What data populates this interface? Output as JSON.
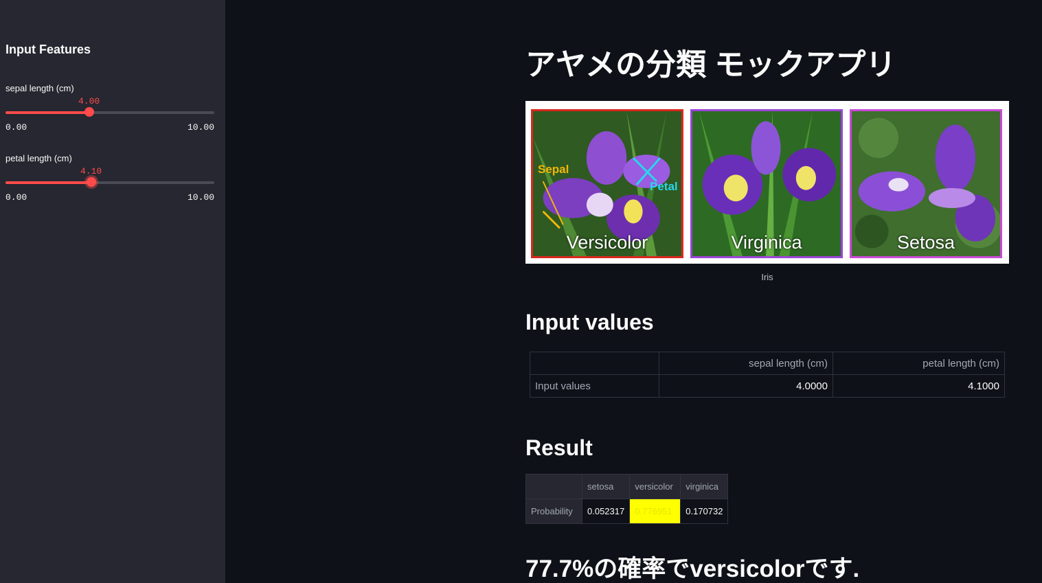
{
  "sidebar": {
    "title": "Input Features",
    "sliders": [
      {
        "label": "sepal length (cm)",
        "value": 4.0,
        "value_text": "4.00",
        "min_text": "0.00",
        "max_text": "10.00"
      },
      {
        "label": "petal length (cm)",
        "value": 4.1,
        "value_text": "4.10",
        "min_text": "0.00",
        "max_text": "10.00"
      }
    ]
  },
  "main": {
    "title": "アヤメの分類 モックアプリ",
    "image": {
      "panels": [
        "Versicolor",
        "Virginica",
        "Setosa"
      ],
      "annotations": [
        "Sepal",
        "Petal"
      ],
      "caption": "Iris"
    },
    "input_section": {
      "heading": "Input values",
      "columns": [
        "",
        "sepal length (cm)",
        "petal length (cm)"
      ],
      "row_label": "Input values",
      "values": [
        "4.0000",
        "4.1000"
      ]
    },
    "result_section": {
      "heading": "Result",
      "columns": [
        "",
        "setosa",
        "versicolor",
        "virginica"
      ],
      "row_label": "Probability",
      "values": [
        "0.052317",
        "0.776951",
        "0.170732"
      ],
      "highlight_index": 1,
      "highlight_color": "#ffff00"
    },
    "conclusion": "77.7%の確率でversicolorです."
  },
  "colors": {
    "accent": "#ff4b4b",
    "background": "#0e1117",
    "sidebar": "#262730"
  }
}
